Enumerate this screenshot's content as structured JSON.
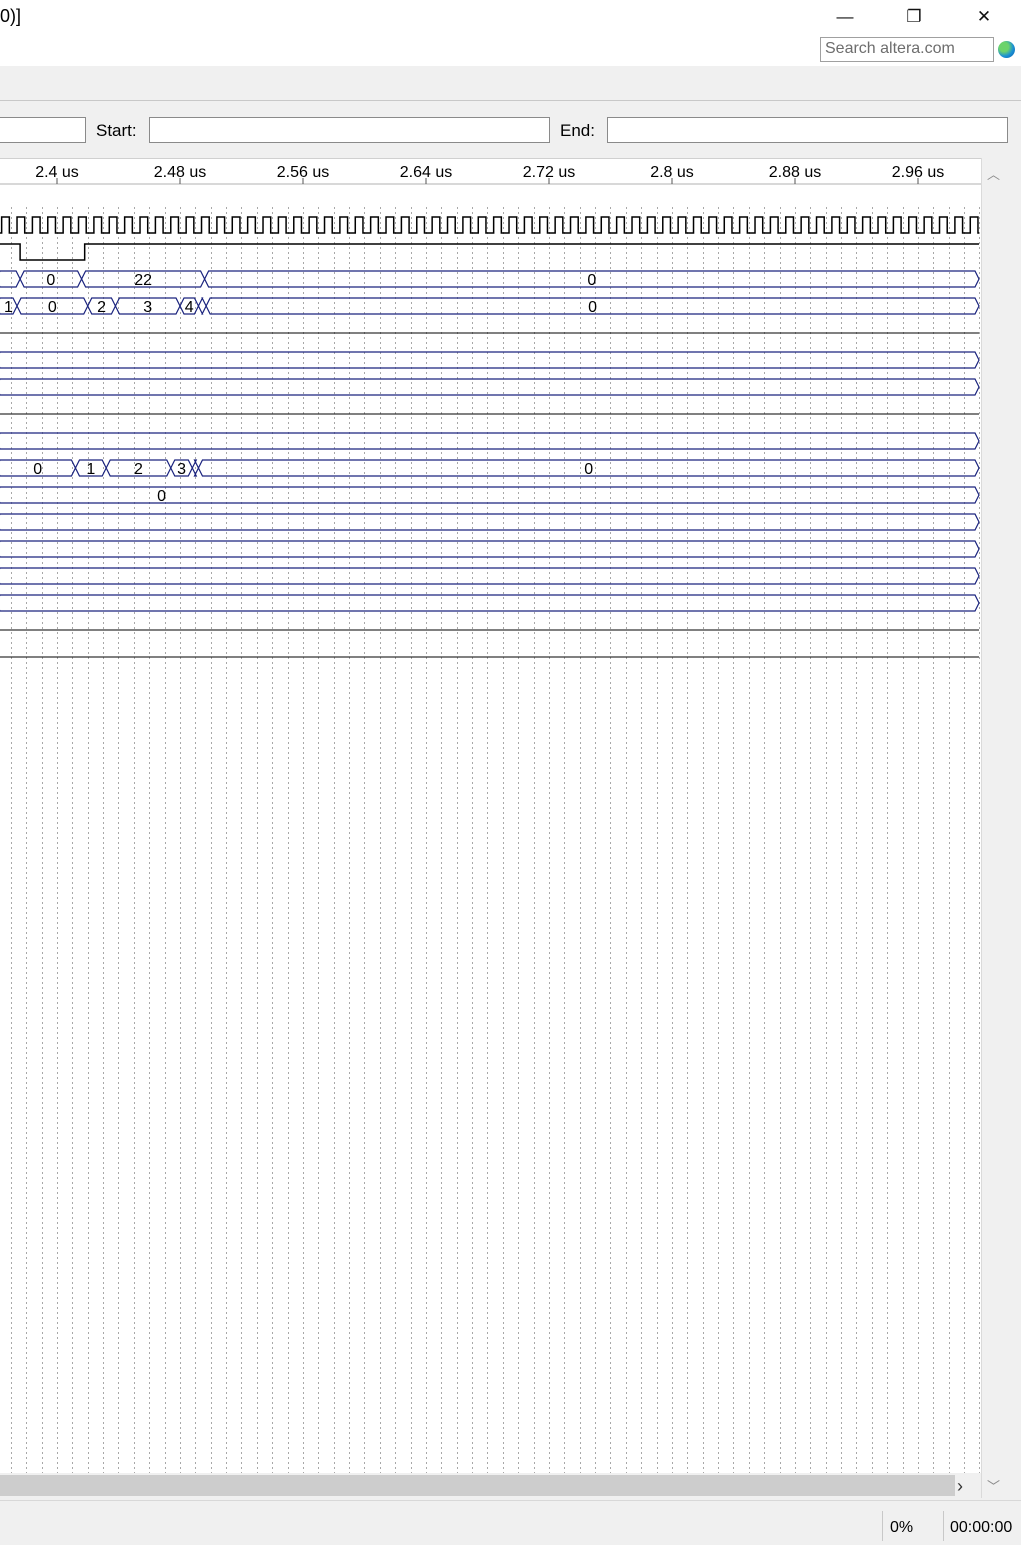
{
  "window": {
    "title_fragment": "0)]",
    "minimize_glyph": "—",
    "restore_glyph": "❐",
    "close_glyph": "✕",
    "search_placeholder": "Search altera.com",
    "globe_icon": "globe-icon"
  },
  "range": {
    "start_label": "Start:",
    "end_label": "End:",
    "start_value": "",
    "end_value": ""
  },
  "timeline": {
    "ticks": [
      "2.4 us",
      "2.48 us",
      "2.56 us",
      "2.64 us",
      "2.72 us",
      "2.8 us",
      "2.88 us",
      "2.96 us"
    ],
    "tick_times_us": [
      2.4,
      2.48,
      2.56,
      2.64,
      2.72,
      2.8,
      2.88,
      2.96
    ]
  },
  "signals": [
    {
      "type": "clock",
      "period_us": 0.01
    },
    {
      "type": "bit",
      "edges_us": [
        2.376,
        2.418
      ],
      "levels": [
        1,
        0,
        1
      ]
    },
    {
      "type": "bus",
      "segments": [
        {
          "t0": 2.354,
          "t1": 2.376,
          "label": ""
        },
        {
          "t0": 2.376,
          "t1": 2.416,
          "label": "0"
        },
        {
          "t0": 2.416,
          "t1": 2.496,
          "label": "22"
        },
        {
          "t0": 2.496,
          "t1": 3.02,
          "label": "0"
        }
      ]
    },
    {
      "type": "bus",
      "segments": [
        {
          "t0": 2.354,
          "t1": 2.374,
          "label": "1"
        },
        {
          "t0": 2.374,
          "t1": 2.42,
          "label": "0"
        },
        {
          "t0": 2.42,
          "t1": 2.438,
          "label": "2"
        },
        {
          "t0": 2.438,
          "t1": 2.48,
          "label": "3"
        },
        {
          "t0": 2.48,
          "t1": 2.492,
          "label": "4"
        },
        {
          "t0": 2.492,
          "t1": 2.497,
          "label": ""
        },
        {
          "t0": 2.497,
          "t1": 3.02,
          "label": "0"
        }
      ]
    },
    {
      "type": "line",
      "color": "#000"
    },
    {
      "type": "bus",
      "segments": [
        {
          "t0": 2.354,
          "t1": 3.02,
          "label": ""
        }
      ]
    },
    {
      "type": "bus",
      "segments": [
        {
          "t0": 2.354,
          "t1": 3.02,
          "label": ""
        }
      ]
    },
    {
      "type": "line",
      "color": "#000"
    },
    {
      "type": "bus",
      "segments": [
        {
          "t0": 2.354,
          "t1": 3.02,
          "label": ""
        }
      ]
    },
    {
      "type": "bus",
      "segments": [
        {
          "t0": 2.354,
          "t1": 2.412,
          "label": "0"
        },
        {
          "t0": 2.412,
          "t1": 2.432,
          "label": "1"
        },
        {
          "t0": 2.432,
          "t1": 2.474,
          "label": "2"
        },
        {
          "t0": 2.474,
          "t1": 2.488,
          "label": "3"
        },
        {
          "t0": 2.488,
          "t1": 2.492,
          "label": ""
        },
        {
          "t0": 2.492,
          "t1": 3.02,
          "label": "0"
        }
      ]
    },
    {
      "type": "bus",
      "segments": [
        {
          "t0": 2.354,
          "t1": 3.02,
          "label": "0",
          "label_at_us": 2.468
        }
      ]
    },
    {
      "type": "bus",
      "segments": [
        {
          "t0": 2.354,
          "t1": 3.02,
          "label": ""
        }
      ]
    },
    {
      "type": "bus",
      "segments": [
        {
          "t0": 2.354,
          "t1": 3.02,
          "label": ""
        }
      ]
    },
    {
      "type": "bus",
      "segments": [
        {
          "t0": 2.354,
          "t1": 3.02,
          "label": ""
        }
      ]
    },
    {
      "type": "bus",
      "segments": [
        {
          "t0": 2.354,
          "t1": 3.02,
          "label": ""
        }
      ]
    },
    {
      "type": "line",
      "color": "#000"
    },
    {
      "type": "line",
      "color": "#000"
    }
  ],
  "status": {
    "progress": "0%",
    "elapsed": "00:00:00"
  }
}
